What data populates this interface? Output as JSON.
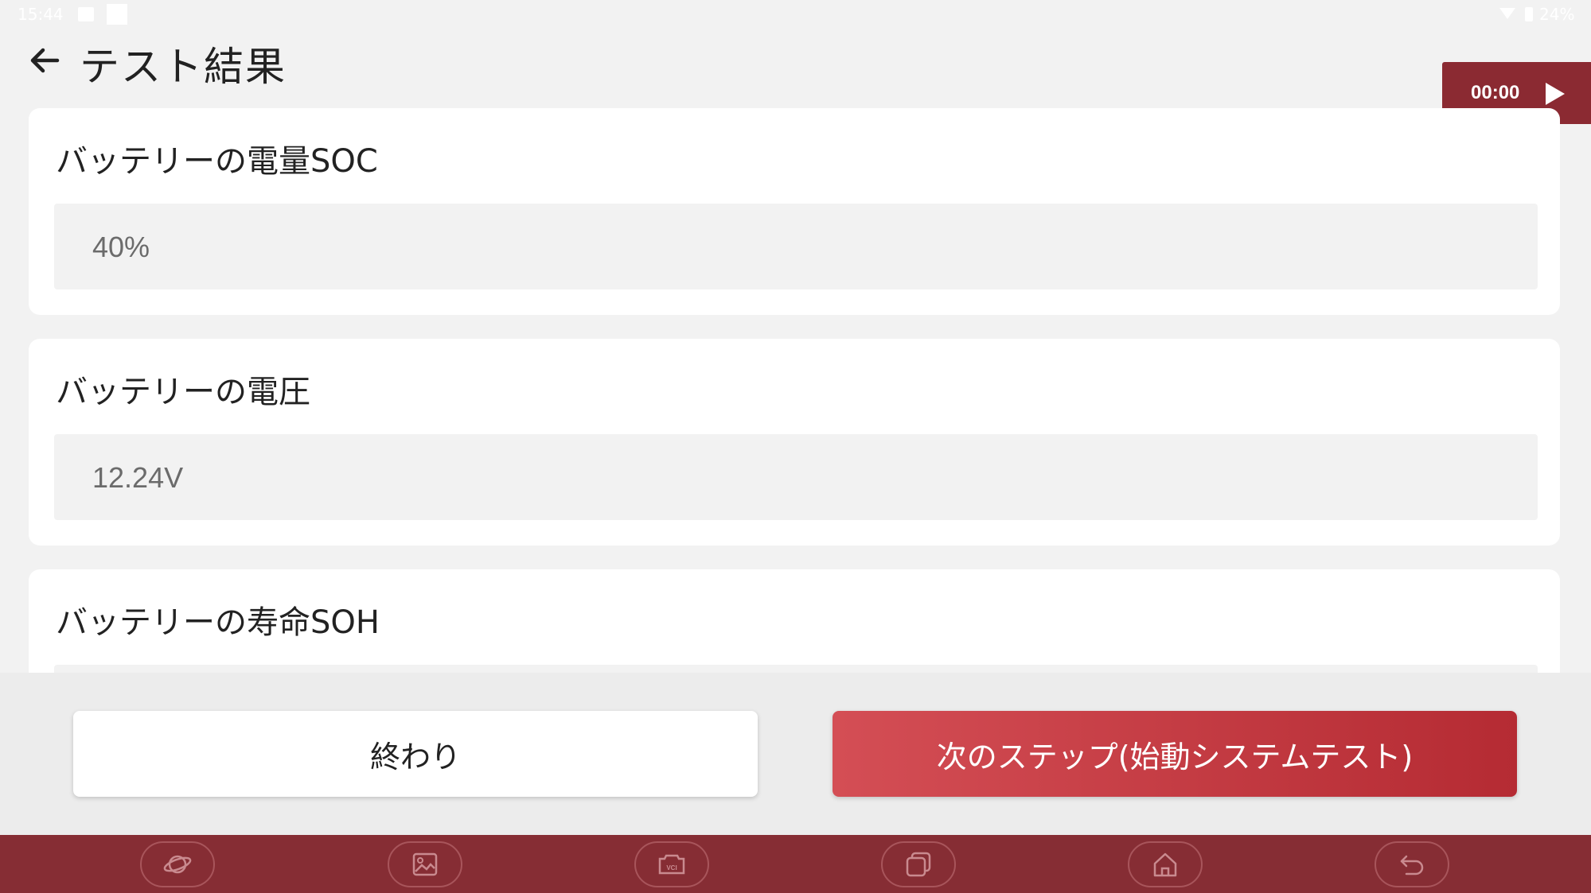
{
  "status_bar": {
    "time": "15:44",
    "battery": "24%",
    "icons": [
      "image-icon",
      "square-icon",
      "wifi-icon",
      "battery-icon"
    ]
  },
  "header": {
    "title": "テスト結果",
    "back_icon": "back-arrow-icon"
  },
  "timer": {
    "time": "00:00",
    "play_icon": "play-icon"
  },
  "results": [
    {
      "label": "バッテリーの電量SOC",
      "value": "40%"
    },
    {
      "label": "バッテリーの電圧",
      "value": "12.24V"
    },
    {
      "label": "バッテリーの寿命SOH",
      "value": ""
    }
  ],
  "actions": {
    "finish_label": "終わり",
    "next_label": "次のステップ(始動システムテスト)"
  },
  "nav": {
    "items": [
      "planet-icon",
      "gallery-icon",
      "vci-icon",
      "recent-apps-icon",
      "home-icon",
      "return-icon"
    ],
    "vci_text": "VCI"
  },
  "colors": {
    "accent": "#862d34",
    "primary_button": "#c23a42",
    "background": "#f2f2f2"
  }
}
